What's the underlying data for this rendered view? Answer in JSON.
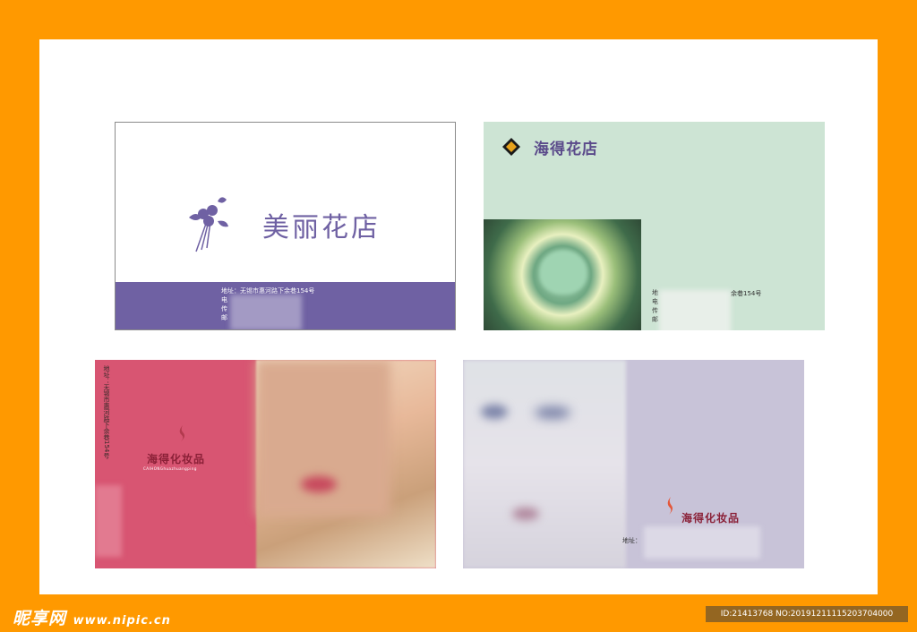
{
  "card1": {
    "shop_name": "美丽花店",
    "contact_lines": [
      "地址：无锡市惠河路下余巷154号",
      "电",
      "传",
      "邮"
    ]
  },
  "card2": {
    "shop_name": "海得花店",
    "contact_lines": [
      "地",
      "电",
      "传",
      "邮"
    ],
    "address_suffix": "余巷154号"
  },
  "card3": {
    "brand_name": "海得化妆品",
    "pinyin": "CAIHONGhuazhuangping",
    "address_vertical": "地址：无锡市惠河路下余巷154号"
  },
  "card4": {
    "brand_name": "海得化妆品",
    "address_label": "地址："
  },
  "watermark": {
    "site_logo": "昵享网",
    "site_url": "www.nipic.cn",
    "id_text": "ID:21413768 NO:20191211115203704000"
  },
  "colors": {
    "frame": "#ff9900",
    "card1_accent": "#6f61a3",
    "card2_bg": "#cde4d4",
    "card3_bg": "#d85572",
    "card4_bg": "#c8c3d8",
    "brand_red": "#8a2037"
  }
}
